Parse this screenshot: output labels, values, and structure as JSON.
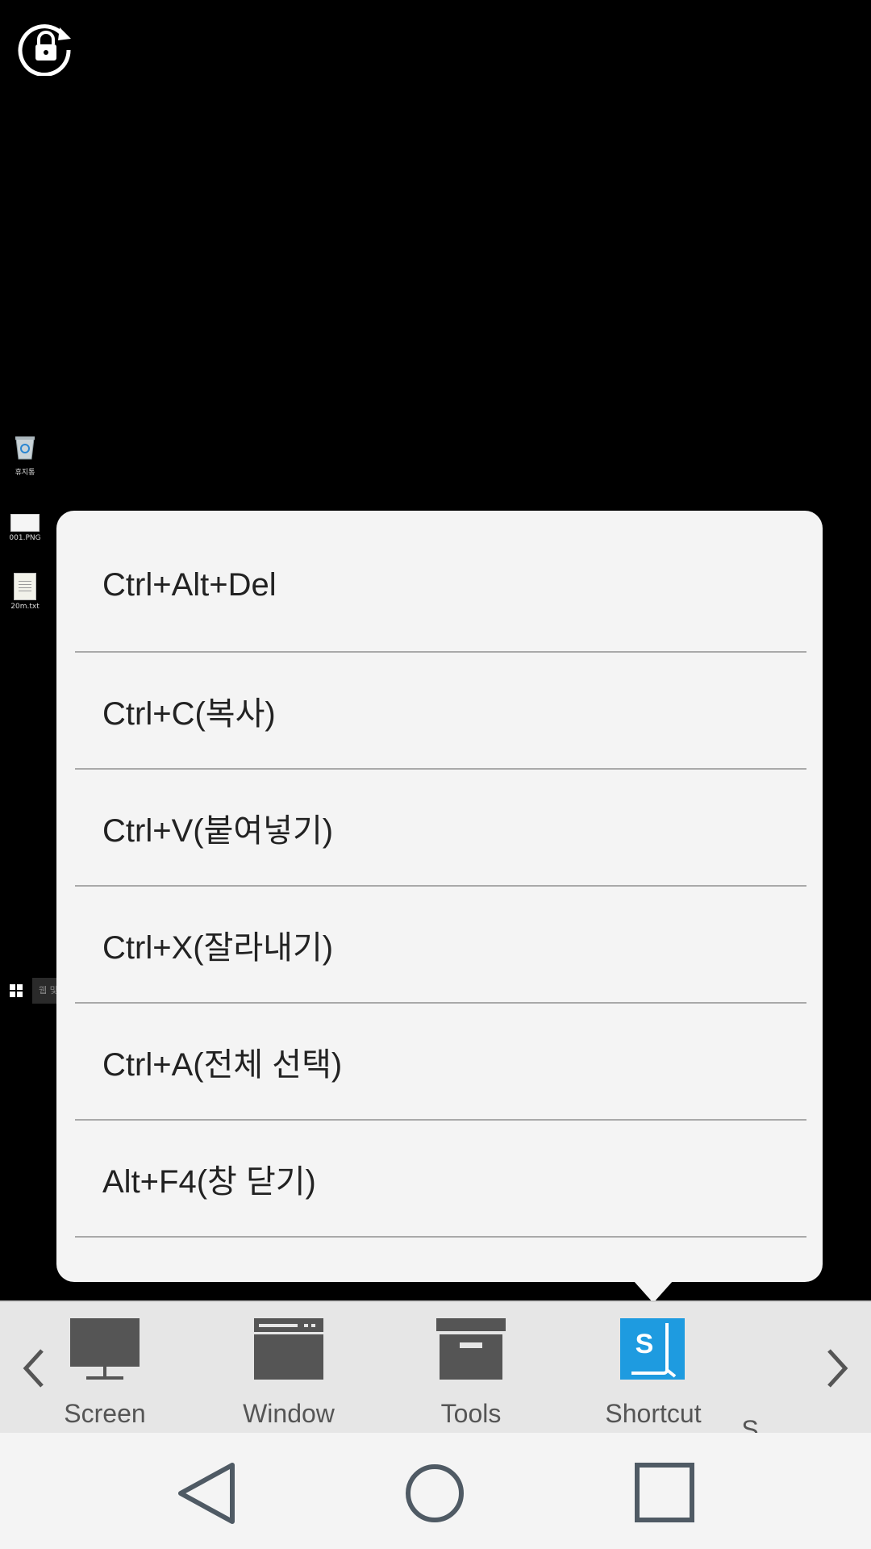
{
  "desktop": {
    "icons": [
      {
        "label": "휴지통"
      },
      {
        "label": "001.PNG"
      },
      {
        "label": "20m.txt"
      }
    ],
    "taskbar_search": "웹 및 Windows 검색"
  },
  "shortcut_menu": {
    "items": [
      {
        "label": "Ctrl+Alt+Del"
      },
      {
        "label": "Ctrl+C(복사)"
      },
      {
        "label": "Ctrl+V(붙여넣기)"
      },
      {
        "label": "Ctrl+X(잘라내기)"
      },
      {
        "label": "Ctrl+A(전체 선택)"
      },
      {
        "label": "Alt+F4(창 닫기)"
      }
    ]
  },
  "toolbar": {
    "items": [
      {
        "label": "Screen",
        "icon": "monitor-icon"
      },
      {
        "label": "Window",
        "icon": "window-icon"
      },
      {
        "label": "Tools",
        "icon": "toolbox-icon"
      },
      {
        "label": "Shortcut",
        "icon": "shortcut-icon",
        "selected": true
      },
      {
        "label": "S",
        "icon": "next-item-partial"
      }
    ]
  },
  "colors": {
    "accent": "#1e9be0",
    "toolbar_icon": "#555555",
    "popup_bg": "#f4f4f4",
    "toolbar_bg": "#e6e6e6"
  }
}
